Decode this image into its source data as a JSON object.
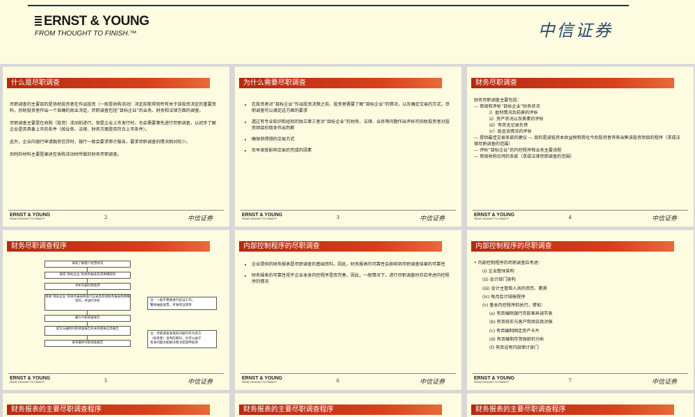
{
  "header": {
    "ey_name": "ERNST & YOUNG",
    "ey_tagline": "FROM THOUGHT TO FINISH.™",
    "cs_name": "中信证券"
  },
  "footer": {
    "ey_name": "ERNST & YOUNG",
    "ey_tagline": "FROM THOUGHT TO FINISH™",
    "cs_name": "中信证券"
  },
  "slides": [
    {
      "title": "什么是尽职调查",
      "page": "2",
      "paragraphs": [
        "尽职调查的主要目的是协助投资者在作出投资（一般是收购活动）决定前能得到所有关于该投资决定的重要资料，协助投资者作出一个准确的商业决定。尽职调查包括“目标企业”的业务、财务和法律方面的调查。",
        "尽职调查主要是在收购（投资）活动前进行，但是企业上市发行时，也会需要事先进行尽职调查，以初步了解企业是否具备上市的条件（按业务、法律、财务方面是否符合上市条件）。",
        "此外，企业向银行申请融资信贷时，银行一般会要求审计报告，要求尽职调查的情况相对较少。",
        "后附的材料主要是阐述在收购活动时所做的财务尽职调查。"
      ]
    },
    {
      "title": "为什么需要尽职调查",
      "page": "3",
      "bullets": [
        "在投资者对“目标企业”作出投资决策之前，投资者需要了解“目标企业”的情况，以及确定交易的方式，尽职调查可以满足这方面的要求",
        "透过有专业知识和经验的独立第三者对“目标企业”的财务、法律、业务等问题作出评析可协助投资者对投资项目的取舍作出判断",
        "确保获得想的交易方式",
        "及早发现影响交易的完成的因素"
      ]
    },
    {
      "title": "财务尽职调查",
      "page": "4",
      "lines": [
        {
          "t": "财务尽职调查主要包括：",
          "lv": 0
        },
        {
          "t": "— 审阅和评析“目标企业”财务状况",
          "lv": 0
        },
        {
          "t": "i）盈利情况及前景的评析",
          "lv": 2
        },
        {
          "t": "ii）资产状况以及质素的评析",
          "lv": 2
        },
        {
          "t": "iii）有否无记录负债",
          "lv": 2
        },
        {
          "t": "iv）现金流情况的评析",
          "lv": 2
        },
        {
          "t": "— 提供最佳交易条款的建议 — 目的是减低资本收益税和简化今后投资者将来出售该投资项目的程序（求成法律尽职调查的范围）",
          "lv": 0
        },
        {
          "t": "— 评析“目标企业”的内控程序和业务主要流程",
          "lv": 0
        },
        {
          "t": "— 审阅收购合同的条款（求成法律尽职调查的范围）",
          "lv": 0
        }
      ]
    },
    {
      "title": "财务尽职调查程序",
      "page": "5",
      "flow": [
        "采购了解客户经营状况",
        "取得“目标企业”的财务报表及其明细资料",
        "评析内部控制程序",
        "审阅“目标企业”的财务报表和会计记录及检测财务报表和明细资料，并进行评析",
        "编写尽职调查报告",
        "提交与编制尽职调查报告有关的相关信息报告",
        "发布最终尽职调查报告"
      ],
      "notes": [
        "注：一般不需要进行验证工作。",
        "譬如抽查发票，考发购证或存",
        "注：尽职调查发现的问题可作为买方",
        "（投资者）谈判的筹码，也可以由于",
        "有关问题太能解决而决定放弃投资"
      ]
    },
    {
      "title": "内部控制程序的尽职调查",
      "page": "6",
      "bullets": [
        "企业提供的财务报表是尽职调查的基础资料，因此，财务报表的可靠性会影响到尽职调查结果的可靠性",
        "财务报表的可靠性视乎企业本身内控程序是否完善，因此，一般情况下，进行尽职调查时亦应考虑内控程序的情况"
      ]
    },
    {
      "title": "内部控制程序的尽职调查",
      "page": "7",
      "lines": [
        {
          "t": "•  内部控制程序的尽职调查应考虑：",
          "lv": 0
        },
        {
          "t": "(i)   企业整体架构",
          "lv": 1
        },
        {
          "t": "(ii)  会计部门架构",
          "lv": 1
        },
        {
          "t": "(iii) 会计主管和人员的资历、素质",
          "lv": 1
        },
        {
          "t": "(iv)  每月会计结帐程序",
          "lv": 1
        },
        {
          "t": "(v)   基本内控程序的执行，譬如：",
          "lv": 1
        },
        {
          "t": "(a) 有否编制银行存款差异调节表",
          "lv": 2
        },
        {
          "t": "(b) 有否核实与客户和供应商对帐",
          "lv": 2
        },
        {
          "t": "(c) 有否编制固定资产卡片",
          "lv": 2
        },
        {
          "t": "(d) 有否编制存货账龄的分析",
          "lv": 2
        },
        {
          "t": "(f) 有否设有内部审计部门",
          "lv": 2
        }
      ]
    },
    {
      "title": "财务报表的主要尽职调查程序"
    },
    {
      "title": "财务报表的主要尽职调查程序"
    },
    {
      "title": "财务报表的主要尽职调查程序"
    }
  ]
}
